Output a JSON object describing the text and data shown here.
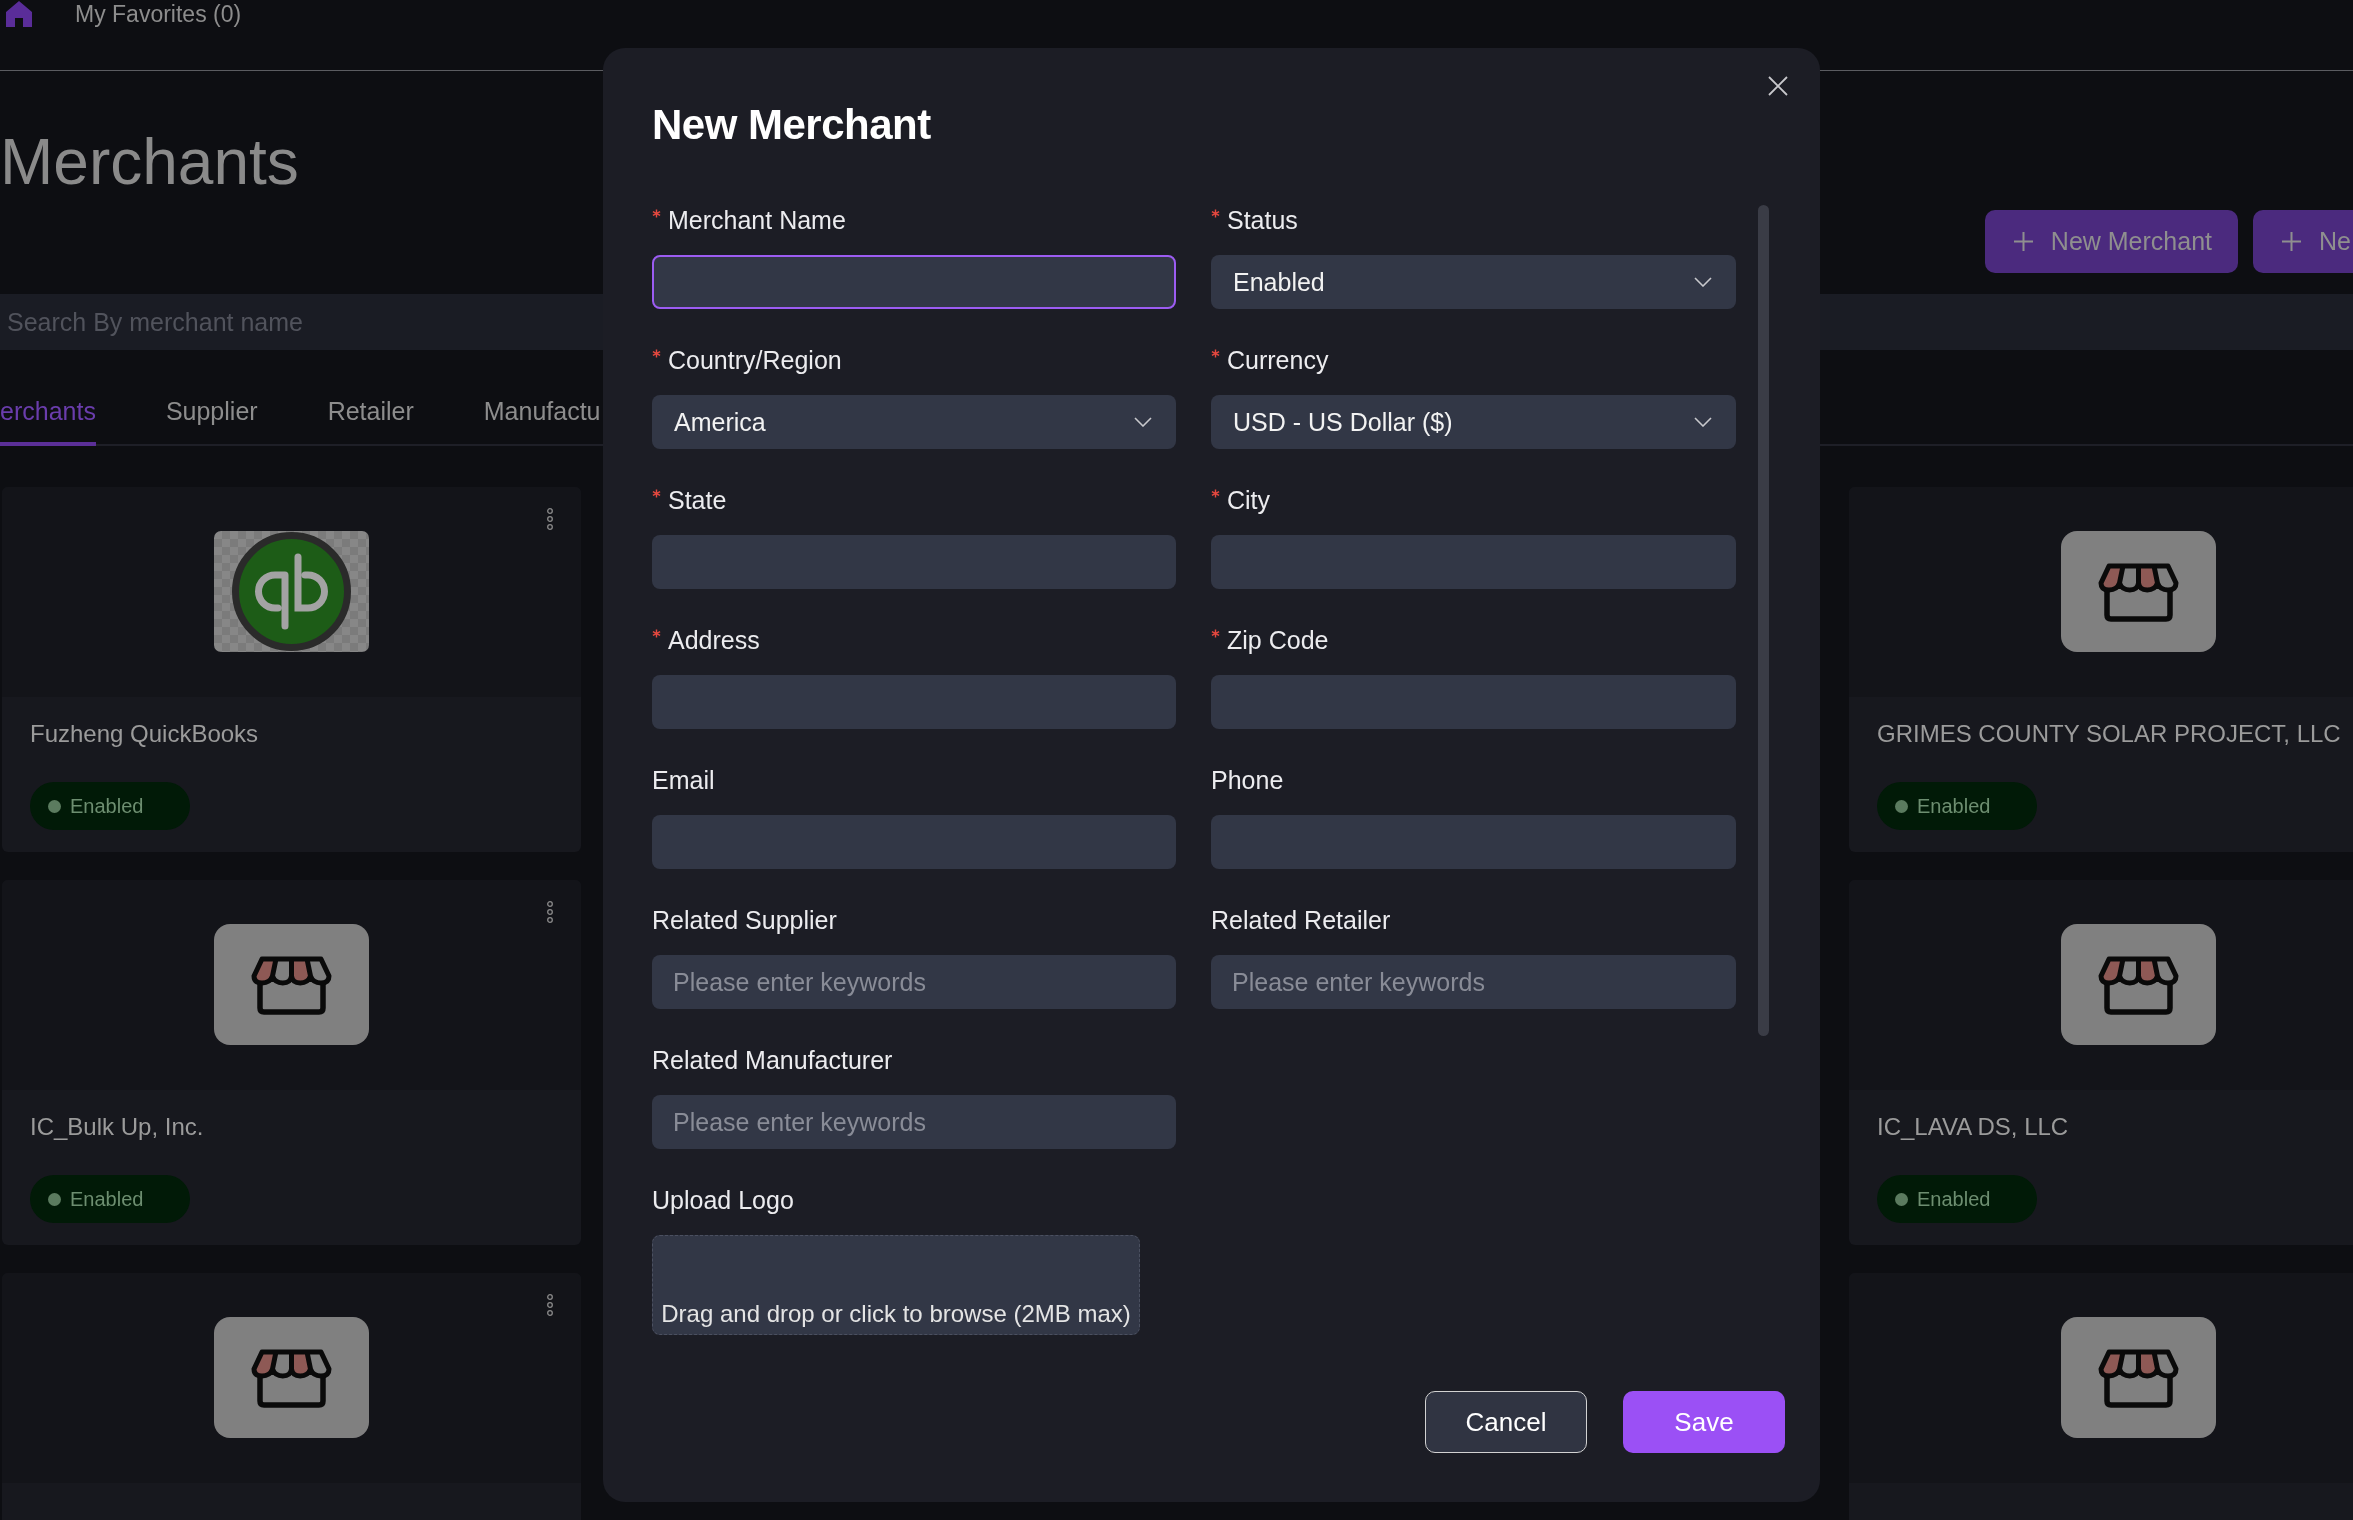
{
  "header": {
    "favorites": "My Favorites (0)"
  },
  "page": {
    "title": "Merchants",
    "actions": [
      {
        "label": "New Merchant"
      },
      {
        "label": "Ne"
      }
    ],
    "search": {
      "placeholder": "Search By merchant name"
    },
    "tabs": [
      {
        "label": "erchants",
        "selected": true
      },
      {
        "label": "Supplier",
        "selected": false
      },
      {
        "label": "Retailer",
        "selected": false
      },
      {
        "label": "Manufactu",
        "selected": false
      }
    ]
  },
  "cards": [
    {
      "kind": "logo",
      "name": "Fuzheng QuickBooks",
      "status": "Enabled"
    },
    {
      "kind": "store",
      "name": "GRIMES COUNTY SOLAR PROJECT, LLC",
      "status": "Enabled"
    },
    {
      "kind": "store",
      "name": "IC_Bulk Up, Inc.",
      "status": "Enabled"
    },
    {
      "kind": "store",
      "name": "IC_LAVA DS, LLC",
      "status": "Enabled"
    },
    {
      "kind": "store"
    },
    {
      "kind": "store"
    }
  ],
  "modal": {
    "title": "New Merchant",
    "fields": [
      {
        "label": "Merchant Name",
        "required": true,
        "kind": "input",
        "focused": true
      },
      {
        "label": "Status",
        "required": true,
        "kind": "select",
        "value": "Enabled",
        "focused": false
      },
      {
        "label": "Country/Region",
        "required": true,
        "kind": "select",
        "value": "America",
        "focused": false
      },
      {
        "label": "Currency",
        "required": true,
        "kind": "select",
        "value": "USD - US Dollar ($)",
        "focused": false
      },
      {
        "label": "State",
        "required": true,
        "kind": "input",
        "focused": false
      },
      {
        "label": "City",
        "required": true,
        "kind": "input",
        "focused": false
      },
      {
        "label": "Address",
        "required": true,
        "kind": "input",
        "focused": false
      },
      {
        "label": "Zip Code",
        "required": true,
        "kind": "input",
        "focused": false
      },
      {
        "label": "Email",
        "required": false,
        "kind": "input",
        "focused": false
      },
      {
        "label": "Phone",
        "required": false,
        "kind": "input",
        "focused": false
      },
      {
        "label": "Related Supplier",
        "required": false,
        "kind": "input",
        "placeholder": "Please enter keywords",
        "focused": false
      },
      {
        "label": "Related Retailer",
        "required": false,
        "kind": "input",
        "placeholder": "Please enter keywords",
        "focused": false
      },
      {
        "label": "Related Manufacturer",
        "required": false,
        "kind": "input",
        "placeholder": "Please enter keywords",
        "focused": false
      },
      {
        "label": "Upload Logo",
        "required": false,
        "kind": "upload",
        "hint": "Drag and drop or click to browse (2MB max)"
      }
    ],
    "buttons": [
      {
        "label": "Cancel",
        "kind": "cancel"
      },
      {
        "label": "Save",
        "kind": "save"
      }
    ]
  }
}
